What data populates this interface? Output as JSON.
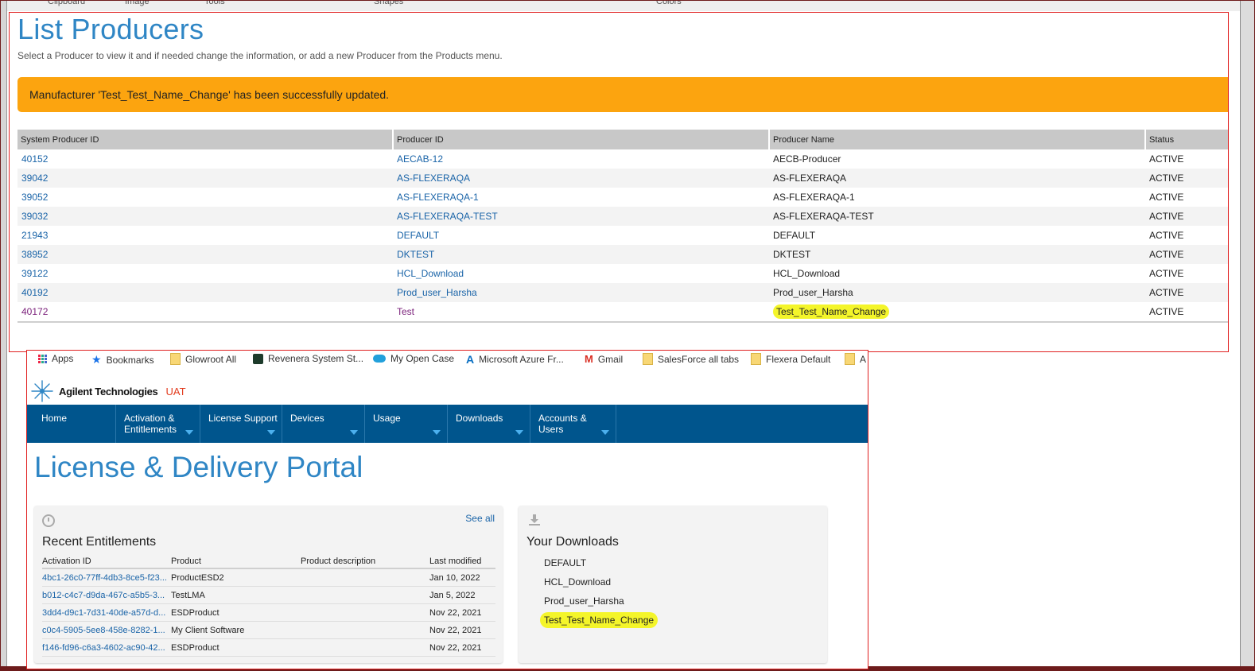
{
  "ribbon": {
    "labels": [
      "Clipboard",
      "Image",
      "Tools",
      "Shapes",
      "Colors"
    ]
  },
  "top": {
    "title": "List Producers",
    "subtitle": "Select a Producer to view it and if needed change the information, or add a new Producer from the Products menu.",
    "alert": "Manufacturer 'Test_Test_Name_Change' has been successfully updated.",
    "columns": [
      "System Producer ID",
      "Producer ID",
      "Producer Name",
      "Status"
    ],
    "rows": [
      {
        "sys": "40152",
        "pid": "AECAB-12",
        "name": "AECB-Producer",
        "status": "ACTIVE"
      },
      {
        "sys": "39042",
        "pid": "AS-FLEXERAQA",
        "name": "AS-FLEXERAQA",
        "status": "ACTIVE"
      },
      {
        "sys": "39052",
        "pid": "AS-FLEXERAQA-1",
        "name": "AS-FLEXERAQA-1",
        "status": "ACTIVE"
      },
      {
        "sys": "39032",
        "pid": "AS-FLEXERAQA-TEST",
        "name": "AS-FLEXERAQA-TEST",
        "status": "ACTIVE"
      },
      {
        "sys": "21943",
        "pid": "DEFAULT",
        "name": "DEFAULT",
        "status": "ACTIVE"
      },
      {
        "sys": "38952",
        "pid": "DKTEST",
        "name": "DKTEST",
        "status": "ACTIVE"
      },
      {
        "sys": "39122",
        "pid": "HCL_Download",
        "name": "HCL_Download",
        "status": "ACTIVE"
      },
      {
        "sys": "40192",
        "pid": "Prod_user_Harsha",
        "name": "Prod_user_Harsha",
        "status": "ACTIVE"
      },
      {
        "sys": "40172",
        "pid": "Test",
        "name": "Test_Test_Name_Change",
        "status": "ACTIVE"
      }
    ]
  },
  "bookmarks": [
    "Apps",
    "Bookmarks",
    "Glowroot All",
    "Revenera System St...",
    "My Open Case",
    "Microsoft Azure Fr...",
    "Gmail",
    "SalesForce all tabs",
    "Flexera Default",
    "A"
  ],
  "brand": {
    "name": "Agilent Technologies",
    "env": "UAT"
  },
  "nav": [
    {
      "l1": "Home",
      "l2": "",
      "caret": false
    },
    {
      "l1": "Activation &",
      "l2": "Entitlements",
      "caret": true
    },
    {
      "l1": "License Support",
      "l2": "",
      "caret": true
    },
    {
      "l1": "Devices",
      "l2": "",
      "caret": true
    },
    {
      "l1": "Usage",
      "l2": "",
      "caret": true
    },
    {
      "l1": "Downloads",
      "l2": "",
      "caret": true
    },
    {
      "l1": "Accounts &",
      "l2": "Users",
      "caret": true
    }
  ],
  "portal": {
    "title": "License & Delivery Portal",
    "see_all": "See all",
    "recent_heading": "Recent Entitlements",
    "ent_columns": [
      "Activation ID",
      "Product",
      "Product description",
      "Last modified"
    ],
    "entitlements": [
      {
        "id": "4bc1-26c0-77ff-4db3-8ce5-f23...",
        "product": "ProductESD2",
        "desc": "",
        "date": "Jan 10, 2022"
      },
      {
        "id": "b012-c4c7-d9da-467c-a5b5-3...",
        "product": "TestLMA",
        "desc": "",
        "date": "Jan 5, 2022"
      },
      {
        "id": "3dd4-d9c1-7d31-40de-a57d-d...",
        "product": "ESDProduct",
        "desc": "",
        "date": "Nov 22, 2021"
      },
      {
        "id": "c0c4-5905-5ee8-458e-8282-1...",
        "product": "My Client Software",
        "desc": "",
        "date": "Nov 22, 2021"
      },
      {
        "id": "f146-fd96-c6a3-4602-ac90-42...",
        "product": "ESDProduct",
        "desc": "",
        "date": "Nov 22, 2021"
      }
    ],
    "downloads_heading": "Your Downloads",
    "downloads": [
      "DEFAULT",
      "HCL_Download",
      "Prod_user_Harsha",
      "Test_Test_Name_Change"
    ]
  },
  "colors": {
    "accent": "#2f86c5",
    "nav": "#00558d",
    "alert": "#fca40f",
    "highlight": "#f4f52a"
  }
}
